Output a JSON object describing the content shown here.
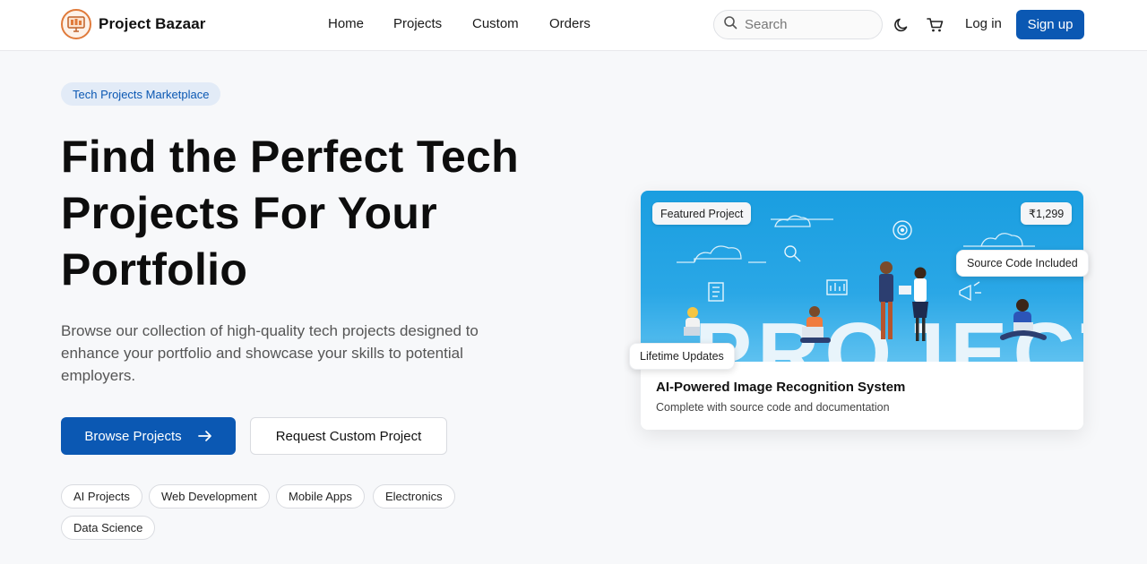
{
  "header": {
    "brand": "Project Bazaar",
    "nav": [
      {
        "label": "Home"
      },
      {
        "label": "Projects"
      },
      {
        "label": "Custom"
      },
      {
        "label": "Orders"
      }
    ],
    "search_placeholder": "Search",
    "login_label": "Log in",
    "signup_label": "Sign up"
  },
  "hero": {
    "badge": "Tech Projects Marketplace",
    "title": "Find the Perfect Tech Projects For Your Portfolio",
    "subtitle": "Browse our collection of high-quality tech projects designed to enhance your portfolio and showcase your skills to potential employers.",
    "primary_button": "Browse Projects",
    "secondary_button": "Request Custom Project",
    "categories": [
      "AI Projects",
      "Web Development",
      "Mobile Apps",
      "Electronics",
      "Data Science"
    ]
  },
  "featured": {
    "badge": "Featured Project",
    "price": "₹1,299",
    "title": "AI-Powered Image Recognition System",
    "description": "Complete with source code and documentation",
    "tag_source": "Source Code Included",
    "tag_updates": "Lifetime Updates",
    "image_word": "PROJECT"
  },
  "colors": {
    "accent": "#0b58b3",
    "badge_bg": "#e2ebf7",
    "card_image": "#1a9ee0"
  },
  "icons": {
    "logo": "monitor-logo-icon",
    "search": "search-icon",
    "theme": "moon-icon",
    "cart": "cart-icon",
    "arrow": "arrow-right-icon"
  }
}
